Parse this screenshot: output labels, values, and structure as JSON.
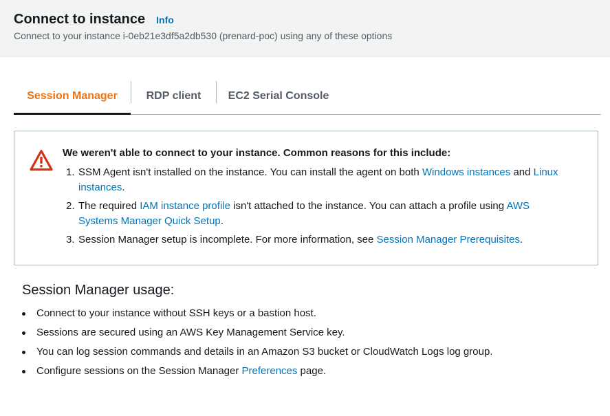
{
  "header": {
    "title": "Connect to instance",
    "info_label": "Info",
    "subtitle": "Connect to your instance i-0eb21e3df5a2db530 (prenard-poc) using any of these options"
  },
  "tabs": [
    {
      "label": "Session Manager",
      "active": true
    },
    {
      "label": "RDP client",
      "active": false
    },
    {
      "label": "EC2 Serial Console",
      "active": false
    }
  ],
  "alert": {
    "icon": "warning-triangle-icon",
    "color": "#d13212",
    "title": "We weren't able to connect to your instance. Common reasons for this include:",
    "items": [
      {
        "num": "1.",
        "text_a": "SSM Agent isn't installed on the instance. You can install the agent on both ",
        "link_a": "Windows instances",
        "text_b": " and ",
        "link_b": "Linux instances",
        "text_c": "."
      },
      {
        "num": "2.",
        "text_a": "The required ",
        "link_a": "IAM instance profile",
        "text_b": " isn't attached to the instance. You can attach a profile using ",
        "link_b": "AWS Systems Manager Quick Setup",
        "text_c": "."
      },
      {
        "num": "3.",
        "text_a": "Session Manager setup is incomplete. For more information, see ",
        "link_a": "Session Manager Prerequisites",
        "text_b": "."
      }
    ]
  },
  "usage": {
    "title": "Session Manager usage:",
    "items": [
      "Connect to your instance without SSH keys or a bastion host.",
      "Sessions are secured using an AWS Key Management Service key.",
      "You can log session commands and details in an Amazon S3 bucket or CloudWatch Logs log group."
    ],
    "last_item": {
      "text_a": "Configure sessions on the Session Manager ",
      "link": "Preferences",
      "text_b": " page."
    }
  },
  "colors": {
    "accent_tab": "#ec7211",
    "link": "#0073bb",
    "error": "#d13212"
  }
}
